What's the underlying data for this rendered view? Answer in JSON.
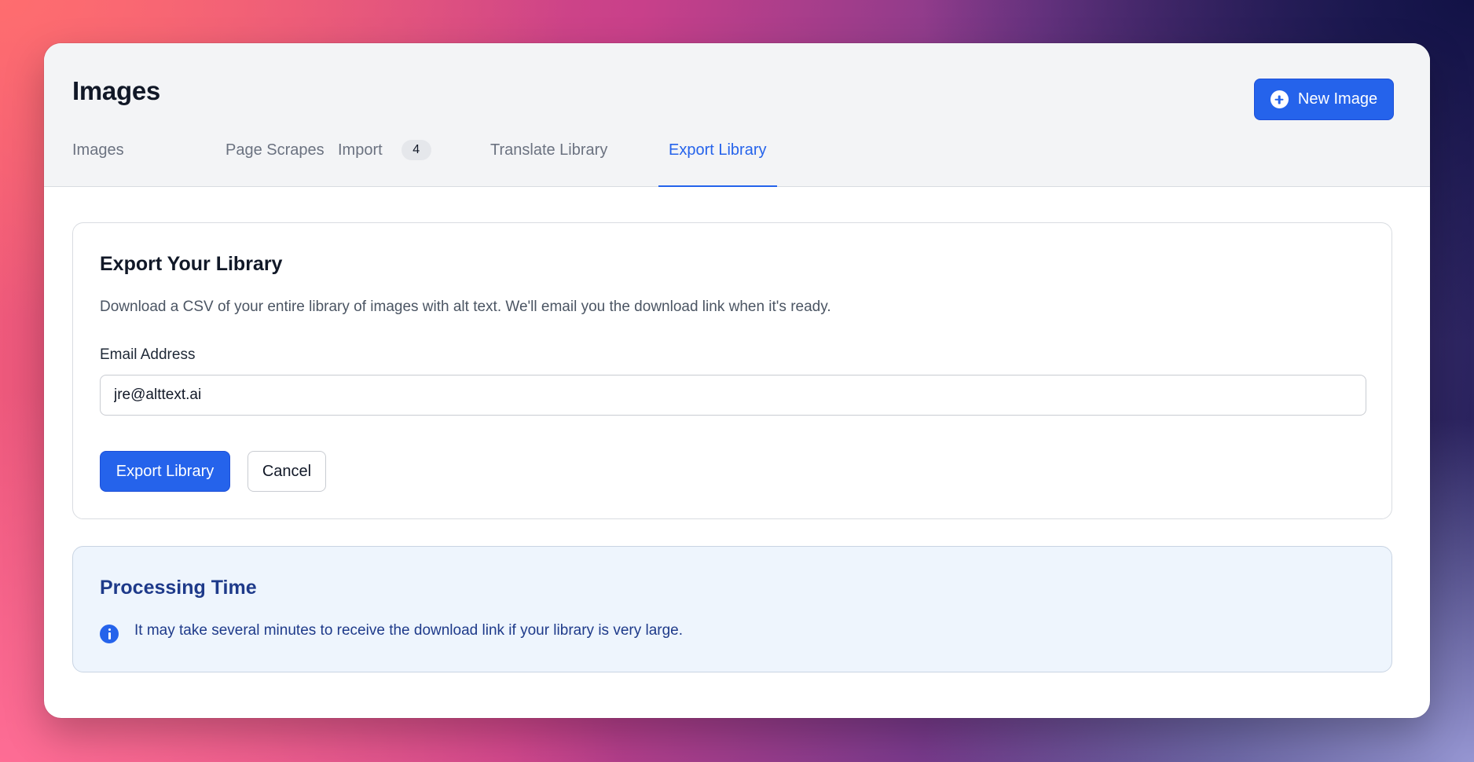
{
  "header": {
    "title": "Images",
    "new_button_label": "New Image",
    "new_button_icon": "plus-circle-icon"
  },
  "tabs": [
    {
      "label": "Images"
    },
    {
      "label": "Page Scrapes"
    },
    {
      "label": "Import",
      "badge": "4"
    },
    {
      "label": "Translate Library"
    },
    {
      "label": "Export Library",
      "active": true
    }
  ],
  "export_card": {
    "title": "Export Your Library",
    "description": "Download a CSV of your entire library of images with alt text. We'll email you the download link when it's ready.",
    "email_label": "Email Address",
    "email_value": "jre@alttext.ai",
    "export_button_label": "Export Library",
    "cancel_button_label": "Cancel"
  },
  "info_box": {
    "title": "Processing Time",
    "icon": "info-icon",
    "text": "It may take several minutes to receive the download link if your library is very large."
  },
  "colors": {
    "accent": "#2563eb",
    "info_bg": "#eef5fd",
    "info_text": "#1e3a8a"
  }
}
